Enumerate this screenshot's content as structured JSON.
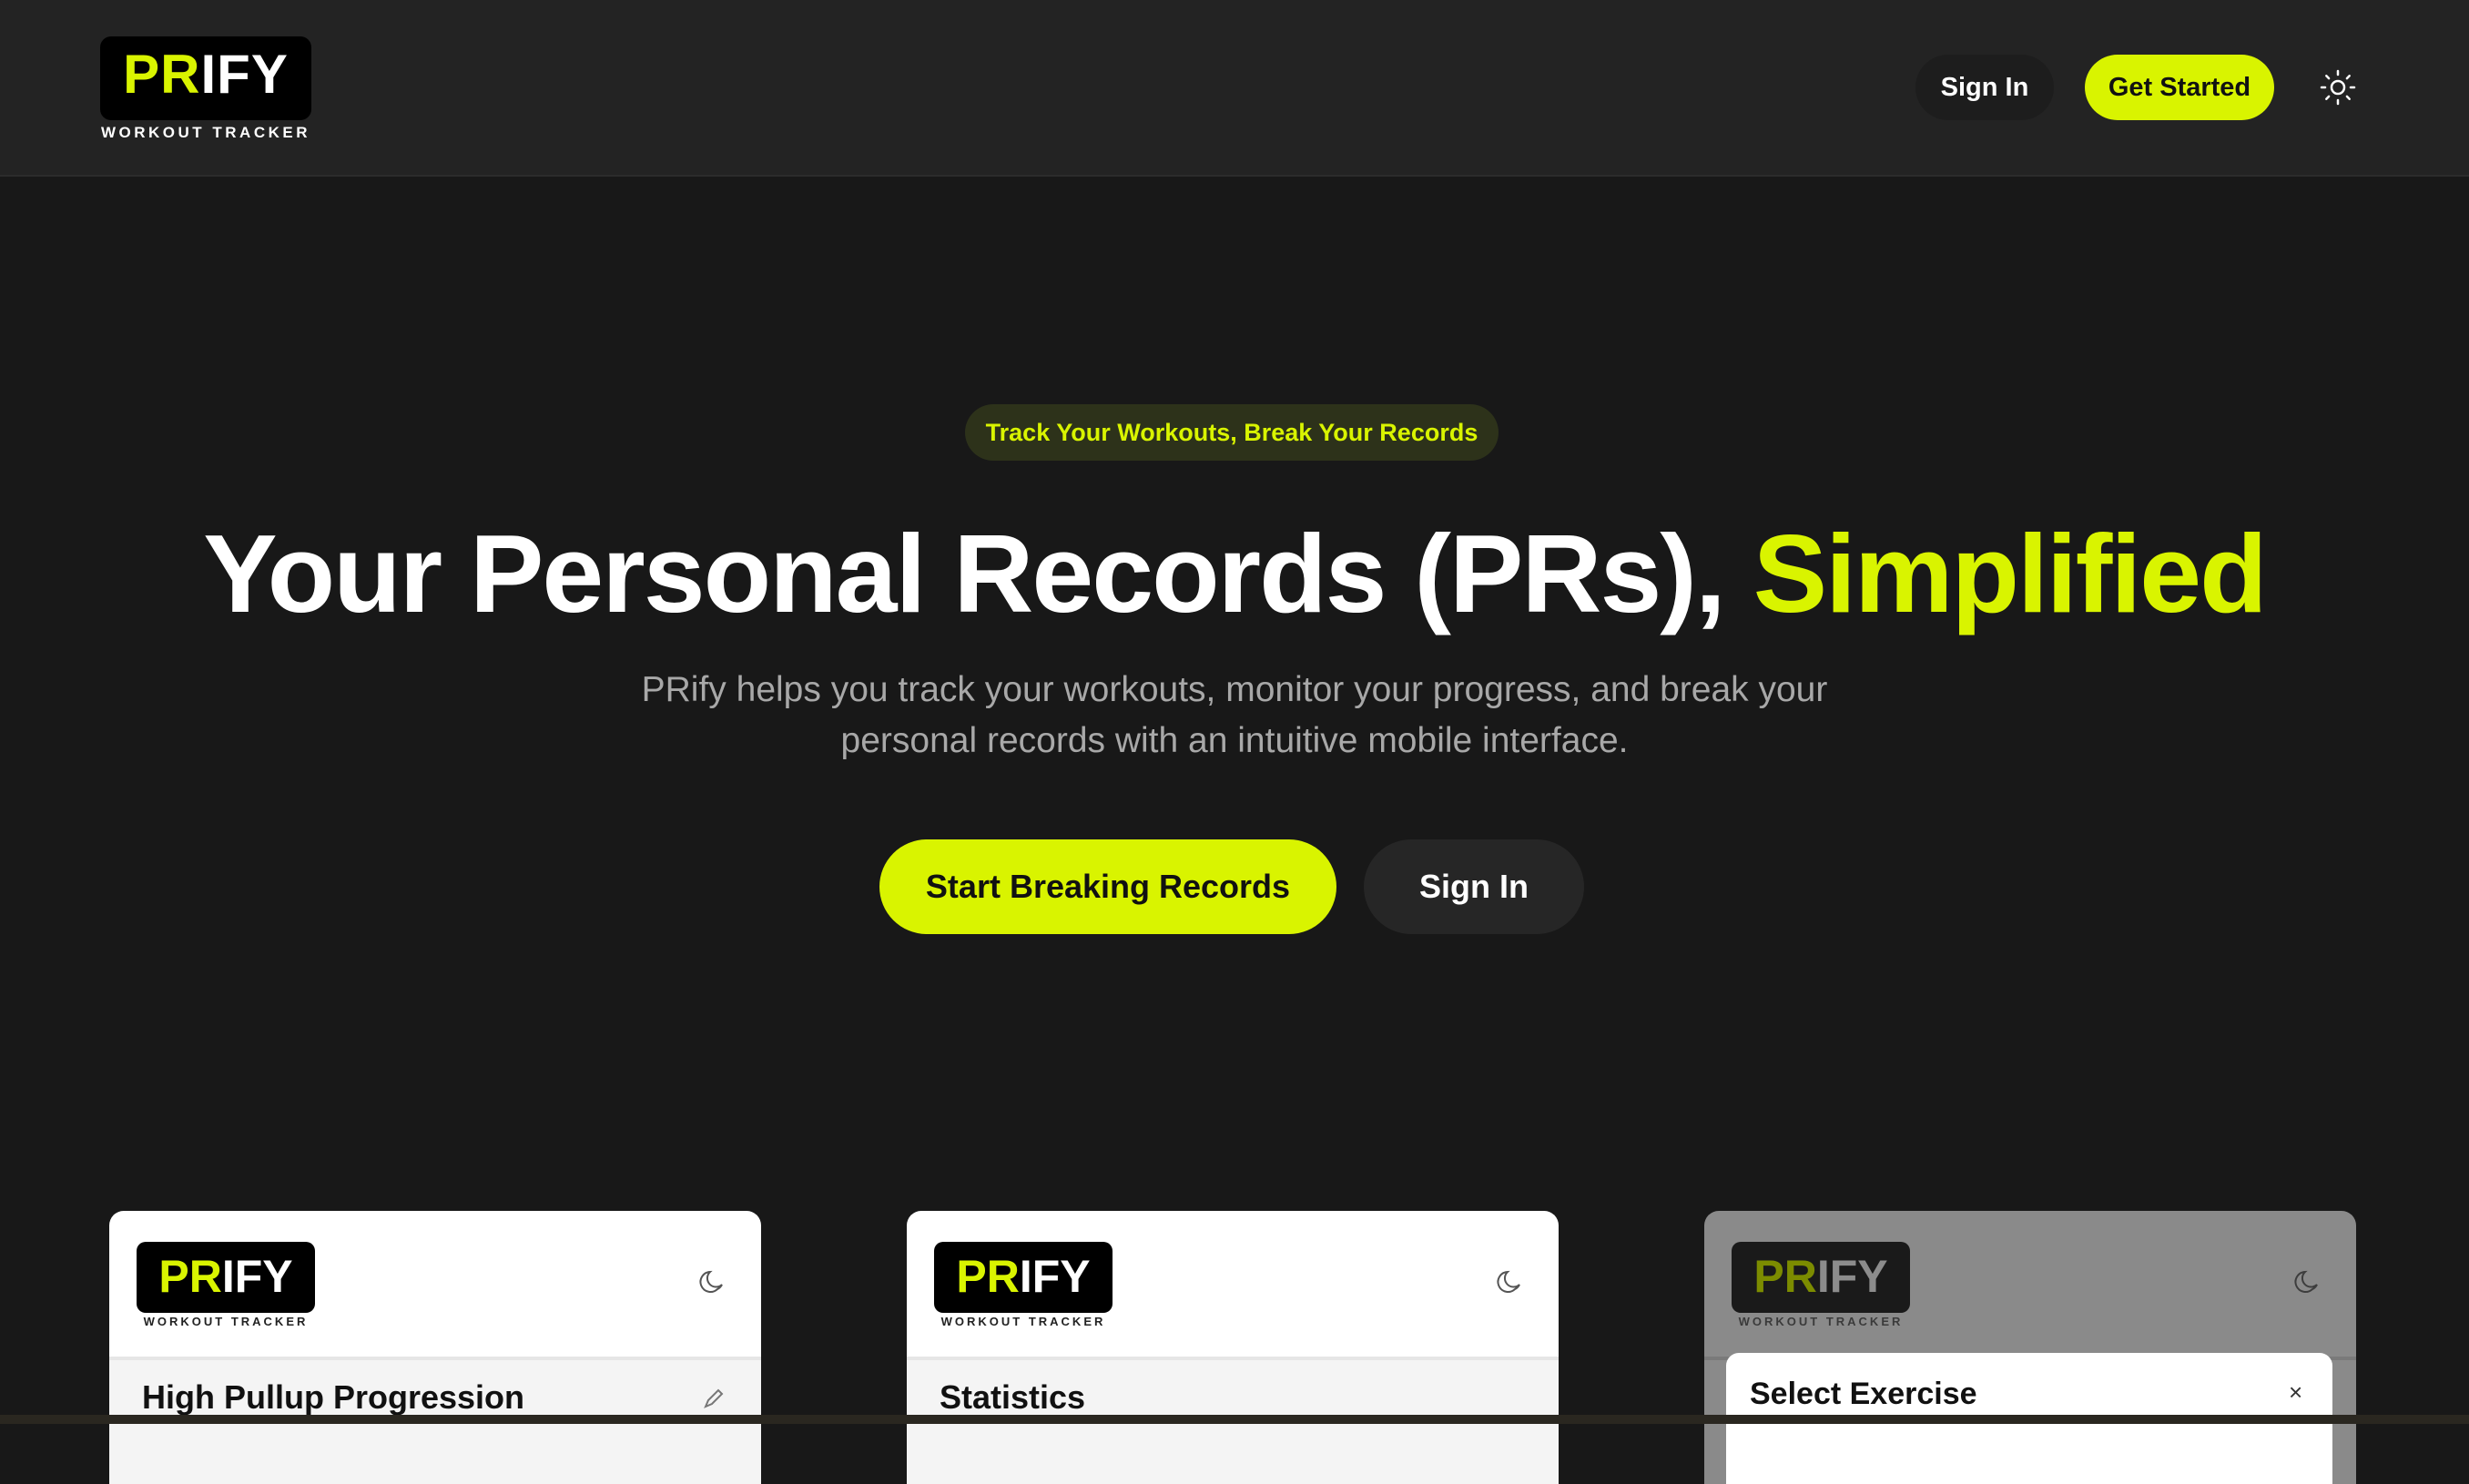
{
  "header": {
    "logo": {
      "wordmark_accent": "PR",
      "wordmark_rest": "IFY",
      "tagline": "WORKOUT TRACKER"
    },
    "sign_in_label": "Sign In",
    "get_started_label": "Get Started",
    "theme_toggle_icon": "sun-icon"
  },
  "hero": {
    "badge": "Track Your Workouts, Break Your Records",
    "title_main": "Your Personal Records (PRs), ",
    "title_accent": "Simplified",
    "subtitle_line1": "PRify helps you track your workouts, monitor your progress, and break your",
    "subtitle_line2": "personal records with an intuitive mobile interface.",
    "primary_cta": "Start Breaking Records",
    "secondary_cta": "Sign In"
  },
  "previews": [
    {
      "logo_accent": "PR",
      "logo_rest": "IFY",
      "logo_tagline": "WORKOUT TRACKER",
      "icon": "moon-icon",
      "title": "High Pullup Progression"
    },
    {
      "logo_accent": "PR",
      "logo_rest": "IFY",
      "logo_tagline": "WORKOUT TRACKER",
      "icon": "moon-icon",
      "title": "Statistics"
    },
    {
      "logo_accent": "PR",
      "logo_rest": "IFY",
      "logo_tagline": "WORKOUT TRACKER",
      "icon": "moon-icon",
      "modal_title": "Select Exercise",
      "modal_close": "×"
    }
  ],
  "colors": {
    "accent": "#d9f400",
    "background": "#181818",
    "header": "#232323",
    "muted_text": "#a8a8a8"
  }
}
